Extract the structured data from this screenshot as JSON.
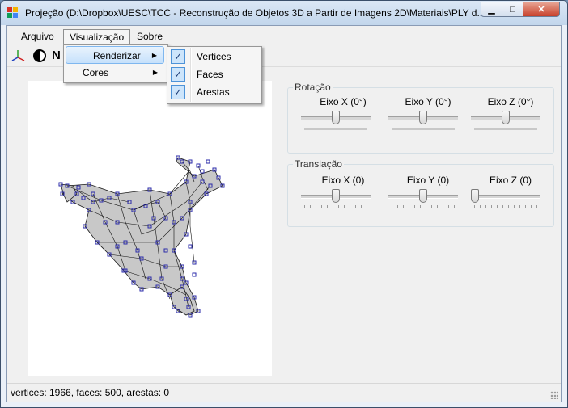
{
  "window": {
    "title": "Projeção (D:\\Dropbox\\UESC\\TCC - Reconstrução de Objetos 3D a Partir de Imagens 2D\\Materiais\\PLY d...",
    "minimize_glyph": "▁",
    "maximize_glyph": "□",
    "close_glyph": "✕"
  },
  "menubar": {
    "items": [
      "Arquivo",
      "Visualização",
      "Sobre"
    ]
  },
  "visualizacao_menu": {
    "items": [
      {
        "label": "Renderizar",
        "submenu": true
      },
      {
        "label": "Cores",
        "submenu": true
      }
    ]
  },
  "renderizar_menu": {
    "items": [
      {
        "label": "Vertices",
        "checked": true
      },
      {
        "label": "Faces",
        "checked": true
      },
      {
        "label": "Arestas",
        "checked": true
      }
    ]
  },
  "menu_glyphs": {
    "arrow": "▶",
    "check": "✓"
  },
  "toolbar": {
    "icons": [
      "axes-icon",
      "color-half-icon",
      "n-icon"
    ],
    "n_glyph": "N"
  },
  "rotacao": {
    "title": "Rotação",
    "sliders": [
      {
        "label": "Eixo X (0°)",
        "value": 0.5
      },
      {
        "label": "Eixo Y (0°)",
        "value": 0.5
      },
      {
        "label": "Eixo Z (0°)",
        "value": 0.5
      }
    ]
  },
  "translacao": {
    "title": "Translação",
    "sliders": [
      {
        "label": "Eixo X (0)",
        "value": 0.5
      },
      {
        "label": "Eixo Y (0)",
        "value": 0.5
      },
      {
        "label": "Eixo Z (0)",
        "value": 0.0
      }
    ]
  },
  "status": {
    "text": "vertices: 1966, faces: 500, arestas: 0"
  },
  "colors": {
    "vertex": "#2a2aa8",
    "edge": "#1a1a1a",
    "face": "#c8c8c8",
    "accent": "#3399ff"
  }
}
